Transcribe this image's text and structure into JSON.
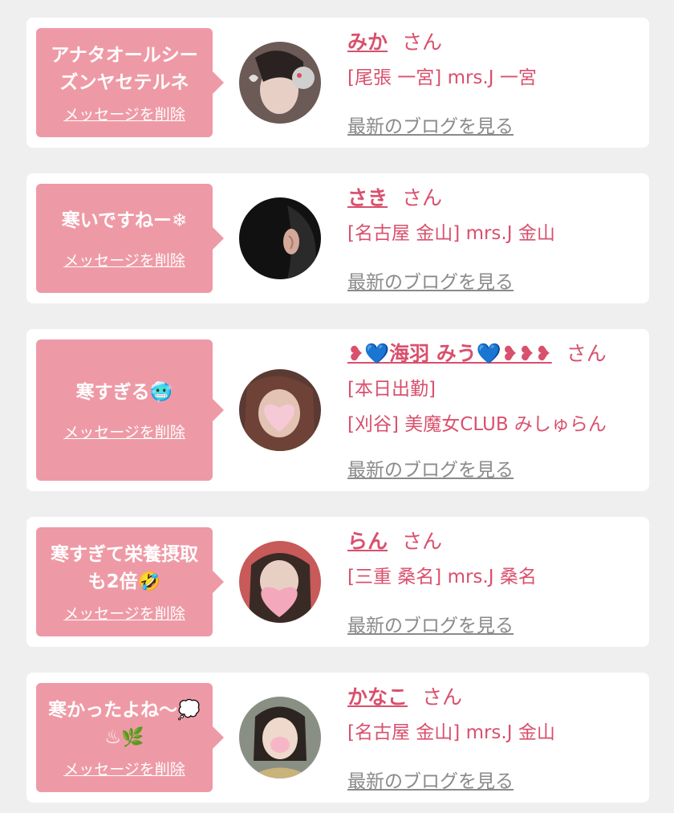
{
  "cards": [
    {
      "message": "アナタオールシーズンヤセテルネ",
      "delete_label": "メッセージを削除",
      "name": "みか",
      "honorific": "さん",
      "shop": "[尾張 一宮] mrs.J 一宮",
      "blog_label": "最新のブログを見る"
    },
    {
      "message": "寒いですねー❄",
      "delete_label": "メッセージを削除",
      "name": "さき",
      "honorific": "さん",
      "shop": "[名古屋 金山] mrs.J 金山",
      "blog_label": "最新のブログを見る"
    },
    {
      "message": "寒すぎる🥶",
      "delete_label": "メッセージを削除",
      "name": "❥💙海羽 みう💙❥❥❥",
      "honorific": "さん",
      "shop_status": "[本日出勤]",
      "shop": "[刈谷] 美魔女CLUB みしゅらん",
      "blog_label": "最新のブログを見る"
    },
    {
      "message": "寒すぎて栄養摂取も2倍🤣",
      "delete_label": "メッセージを削除",
      "name": "らん",
      "honorific": "さん",
      "shop": "[三重 桑名] mrs.J 桑名",
      "blog_label": "最新のブログを見る"
    },
    {
      "message": "寒かったよね〜💭♨🌿",
      "delete_label": "メッセージを削除",
      "name": "かなこ",
      "honorific": "さん",
      "shop": "[名古屋 金山] mrs.J 金山",
      "blog_label": "最新のブログを見る"
    }
  ],
  "avatar_icons": [
    "avatar-photo-icon",
    "avatar-photo-icon",
    "avatar-photo-icon",
    "avatar-photo-icon",
    "avatar-photo-icon"
  ],
  "colors": {
    "background": "#efefef",
    "card": "#ffffff",
    "bubble": "#ee9aa6",
    "accent": "#d9506d",
    "blog_link": "#8a8a8a"
  }
}
